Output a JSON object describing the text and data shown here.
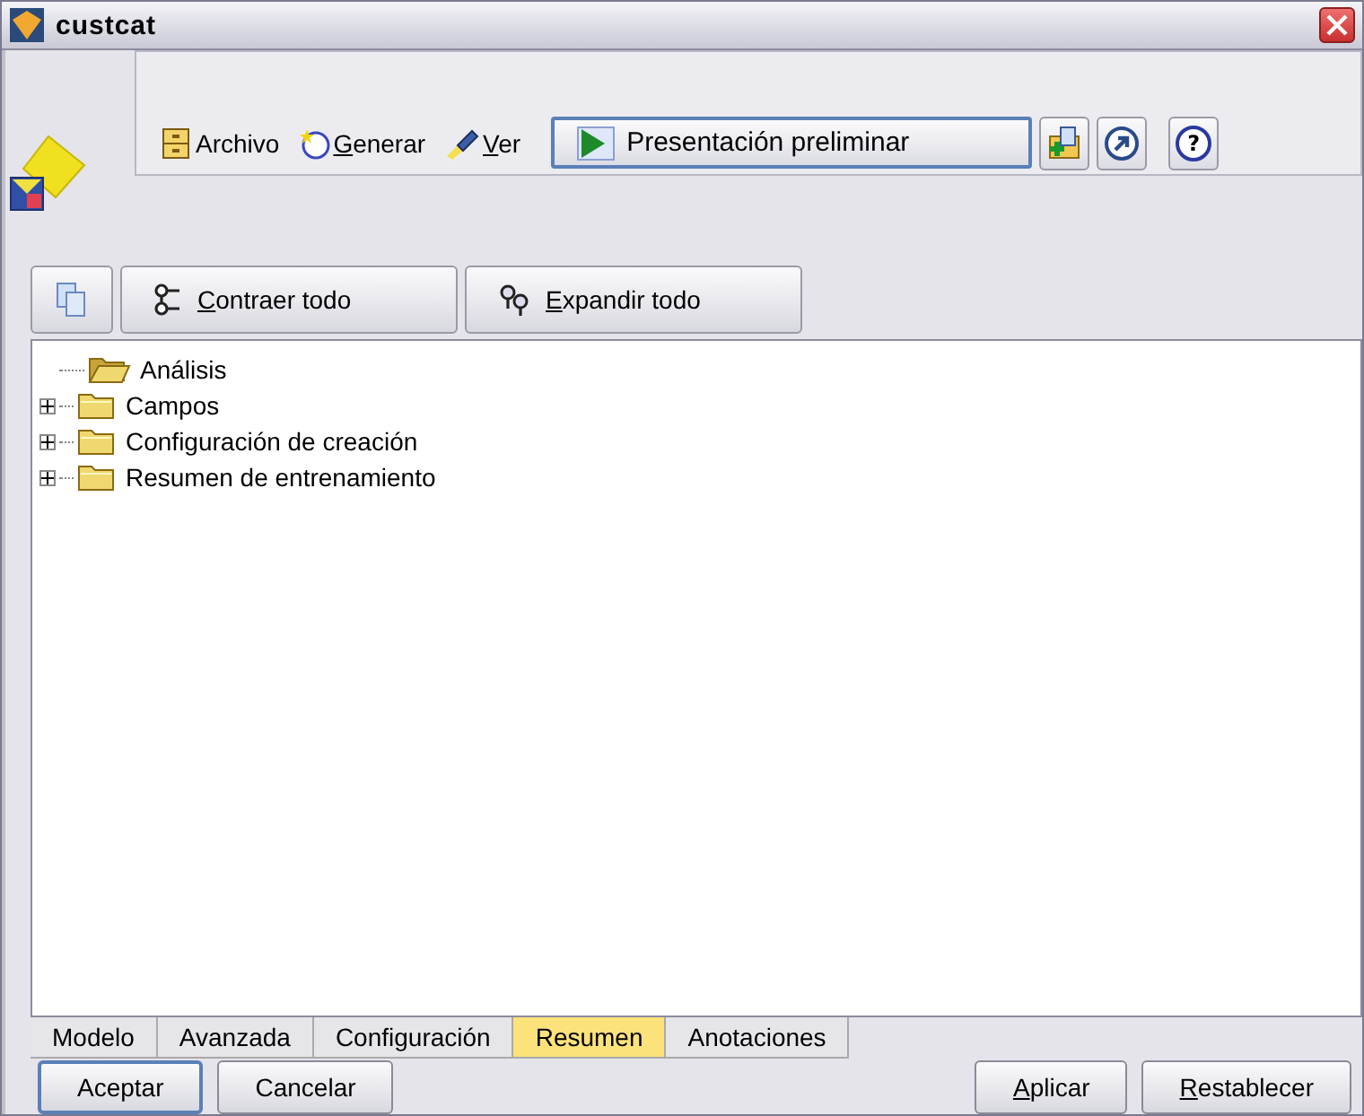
{
  "window": {
    "title": "custcat"
  },
  "toolbar": {
    "menus": [
      {
        "label": "Archivo",
        "underline_first": false
      },
      {
        "label": "Generar",
        "underline_first": true
      },
      {
        "label": "Ver",
        "underline_first": true
      }
    ],
    "preview_button": "Presentación preliminar",
    "help_button": "?"
  },
  "tree_toolbar": [
    {
      "label": "Contraer todo",
      "underline_first": true
    },
    {
      "label": "Expandir todo",
      "underline_first": true
    }
  ],
  "tree": [
    {
      "label": "Análisis",
      "expanded": true
    },
    {
      "label": "Campos",
      "expanded": false
    },
    {
      "label": "Configuración de creación",
      "expanded": false
    },
    {
      "label": "Resumen de entrenamiento",
      "expanded": false
    }
  ],
  "tabs": [
    {
      "label": "Modelo",
      "selected": false
    },
    {
      "label": "Avanzada",
      "selected": false
    },
    {
      "label": "Configuración",
      "selected": false
    },
    {
      "label": "Resumen",
      "selected": true
    },
    {
      "label": "Anotaciones",
      "selected": false
    }
  ],
  "buttons": [
    {
      "label": "Aceptar",
      "underline_first": false,
      "focused": true
    },
    {
      "label": "Cancelar",
      "underline_first": false,
      "focused": false
    },
    {
      "label": "Aplicar",
      "underline_first": true,
      "focused": false
    },
    {
      "label": "Restablecer",
      "underline_first": true,
      "focused": false
    }
  ]
}
